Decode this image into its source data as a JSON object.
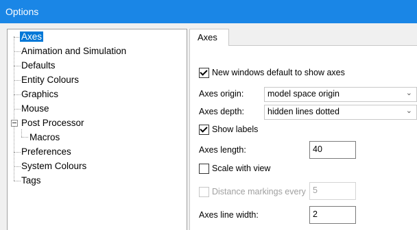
{
  "window": {
    "title": "Options"
  },
  "tree": {
    "items": [
      {
        "label": "Axes",
        "selected": true
      },
      {
        "label": "Animation and Simulation"
      },
      {
        "label": "Defaults"
      },
      {
        "label": "Entity Colours"
      },
      {
        "label": "Graphics"
      },
      {
        "label": "Mouse"
      },
      {
        "label": "Post Processor",
        "expanded": true
      },
      {
        "label": "Macros",
        "child_of": "Post Processor"
      },
      {
        "label": "Preferences"
      },
      {
        "label": "System Colours"
      },
      {
        "label": "Tags"
      }
    ]
  },
  "tab": {
    "label": "Axes"
  },
  "axes": {
    "new_windows": {
      "label": "New windows default to show axes",
      "checked": true
    },
    "origin": {
      "label": "Axes origin:",
      "value": "model space origin"
    },
    "depth": {
      "label": "Axes depth:",
      "value": "hidden lines dotted"
    },
    "show_labels": {
      "label": "Show labels",
      "checked": true
    },
    "length": {
      "label": "Axes length:",
      "value": "40"
    },
    "scale_with_view": {
      "label": "Scale with view",
      "checked": false
    },
    "distance_markings": {
      "label": "Distance markings every",
      "value": "5",
      "enabled": false
    },
    "line_width": {
      "label": "Axes line width:",
      "value": "2"
    }
  },
  "icons": {
    "dropdown": "chevron-down-icon",
    "check": "checkmark-icon",
    "tree_collapse": "minus-box-icon"
  }
}
